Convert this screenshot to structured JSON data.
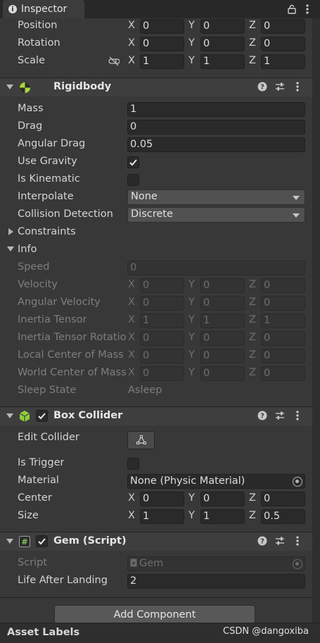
{
  "window": {
    "tab_label": "Inspector",
    "tab_icon": "info-icon"
  },
  "transform": {
    "position": {
      "label": "Position",
      "x": "0",
      "y": "0",
      "z": "0"
    },
    "rotation": {
      "label": "Rotation",
      "x": "0",
      "y": "0",
      "z": "0"
    },
    "scale": {
      "label": "Scale",
      "x": "1",
      "y": "1",
      "z": "1"
    },
    "axis": {
      "x": "X",
      "y": "Y",
      "z": "Z"
    }
  },
  "rigidbody": {
    "title": "Rigidbody",
    "mass": {
      "label": "Mass",
      "value": "1"
    },
    "drag": {
      "label": "Drag",
      "value": "0"
    },
    "angular_drag": {
      "label": "Angular Drag",
      "value": "0.05"
    },
    "use_gravity": {
      "label": "Use Gravity",
      "checked": true
    },
    "is_kinematic": {
      "label": "Is Kinematic",
      "checked": false
    },
    "interpolate": {
      "label": "Interpolate",
      "value": "None"
    },
    "collision_detection": {
      "label": "Collision Detection",
      "value": "Discrete"
    },
    "constraints": {
      "label": "Constraints"
    },
    "info": {
      "label": "Info",
      "speed": {
        "label": "Speed",
        "value": "0"
      },
      "velocity": {
        "label": "Velocity",
        "x": "0",
        "y": "0",
        "z": "0"
      },
      "angular_velocity": {
        "label": "Angular Velocity",
        "x": "0",
        "y": "0",
        "z": "0"
      },
      "inertia_tensor": {
        "label": "Inertia Tensor",
        "x": "1",
        "y": "1",
        "z": "1"
      },
      "inertia_tensor_rotation": {
        "label": "Inertia Tensor Rotatio",
        "x": "0",
        "y": "0",
        "z": "0"
      },
      "local_center_of_mass": {
        "label": "Local Center of Mass",
        "x": "0",
        "y": "0",
        "z": "0"
      },
      "world_center_of_mass": {
        "label": "World Center of Mass",
        "x": "0",
        "y": "0",
        "z": "0"
      },
      "sleep_state": {
        "label": "Sleep State",
        "value": "Asleep"
      }
    }
  },
  "box_collider": {
    "title": "Box Collider",
    "enabled": true,
    "edit_collider": {
      "label": "Edit Collider"
    },
    "is_trigger": {
      "label": "Is Trigger",
      "checked": false
    },
    "material": {
      "label": "Material",
      "value": "None (Physic Material)"
    },
    "center": {
      "label": "Center",
      "x": "0",
      "y": "0",
      "z": "0"
    },
    "size": {
      "label": "Size",
      "x": "1",
      "y": "1",
      "z": "0.5"
    }
  },
  "gem_script": {
    "title": "Gem (Script)",
    "enabled": true,
    "script": {
      "label": "Script",
      "value": "Gem"
    },
    "life_after_landing": {
      "label": "Life After Landing",
      "value": "2"
    }
  },
  "footer": {
    "add_component": "Add Component",
    "asset_labels": "Asset Labels",
    "watermark": "CSDN @dangoxiba"
  },
  "colors": {
    "background": "#383838",
    "field": "#2a2a2a",
    "header": "#3e3e3e",
    "rigidbody_icon": "#a8d63a",
    "collider_icon": "#8ccf3a"
  }
}
